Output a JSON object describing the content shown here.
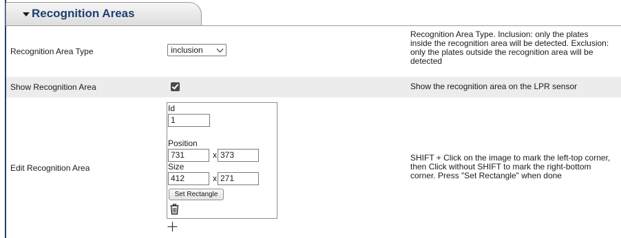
{
  "section": {
    "title": "Recognition Areas",
    "caret_icon": "caret-down-icon"
  },
  "rows": {
    "area_type": {
      "label": "Recognition Area Type",
      "selected": "inclusion",
      "description": [
        "Recognition Area Type. Inclusion: only the plates",
        "inside the recognition area will be detected. Exclusion:",
        "only the plates outside the recognition area will be",
        "detected"
      ]
    },
    "show_area": {
      "label": "Show Recognition Area",
      "checked": true,
      "description": "Show the recognition area on the LPR sensor"
    },
    "edit_area": {
      "label": "Edit Recognition Area",
      "id_label": "Id",
      "id_value": "1",
      "position_label": "Position",
      "position_x": "731",
      "position_y": "373",
      "size_label": "Size",
      "size_w": "412",
      "size_h": "271",
      "separator": "x",
      "set_rectangle_label": "Set Rectangle",
      "delete_icon": "trash-icon",
      "add_icon": "plus-icon",
      "description": [
        "SHIFT + Click on the image to mark the left-top corner,",
        "then Click without SHIFT to mark the right-bottom",
        "corner. Press \"Set Rectangle\" when done"
      ]
    }
  },
  "colors": {
    "accent": "#1e3f73",
    "row_alt": "#ececec",
    "border": "#9a9a9a"
  }
}
